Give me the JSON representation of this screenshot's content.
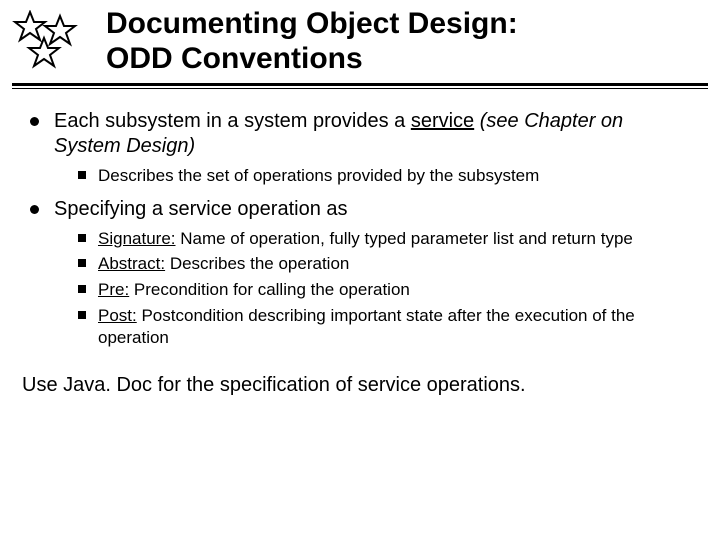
{
  "title_line1": "Documenting Object Design:",
  "title_line2": "ODD Conventions",
  "bullets": [
    {
      "pre": "Each subsystem in a system provides a ",
      "u": "service",
      "post_em": " (see Chapter on System Design)",
      "sub": [
        {
          "text": "Describes the set of operations provided by the subsystem"
        }
      ]
    },
    {
      "pre": "Specifying a service operation  as",
      "sub": [
        {
          "u": "Signature:",
          "rest": " Name of operation, fully typed parameter list and return type"
        },
        {
          "u": "Abstract:",
          "rest": " Describes the operation"
        },
        {
          "u": "Pre:",
          "rest": " Precondition for calling the operation"
        },
        {
          "u": "Post:",
          "rest": " Postcondition describing important state after the execution of the operation"
        }
      ]
    }
  ],
  "footer": "Use Java. Doc for the specification of service operations."
}
